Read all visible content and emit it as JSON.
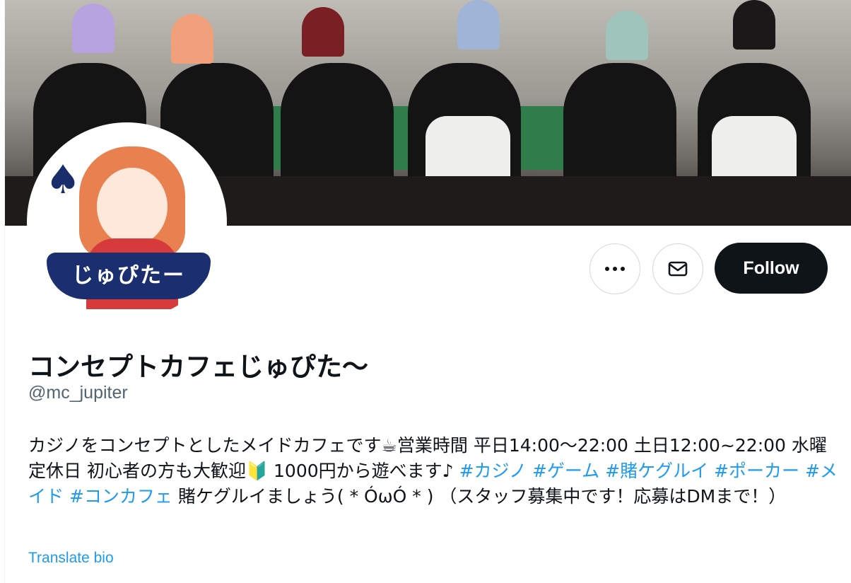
{
  "profile": {
    "display_name": "コンセプトカフェじゅぴた〜",
    "handle": "@mc_jupiter",
    "avatar_text": "じゅぴたー",
    "bio": {
      "segments": [
        {
          "text": "カジノをコンセプトとしたメイドカフェです☕営業時間 平日14:00〜22:00 土日12:00~22:00 水曜定休日 初心者の方も大歓迎🔰 1000円から遊べます♪ ",
          "tag": false
        },
        {
          "text": "#カジノ",
          "tag": true
        },
        {
          "text": " ",
          "tag": false
        },
        {
          "text": "#ゲーム",
          "tag": true
        },
        {
          "text": " ",
          "tag": false
        },
        {
          "text": "#賭ケグルイ",
          "tag": true
        },
        {
          "text": " ",
          "tag": false
        },
        {
          "text": "#ポーカー",
          "tag": true
        },
        {
          "text": " ",
          "tag": false
        },
        {
          "text": "#メイド",
          "tag": true
        },
        {
          "text": " ",
          "tag": false
        },
        {
          "text": "#コンカフェ",
          "tag": true
        },
        {
          "text": " 賭ケグルイましょう( * ÓωÓ * ) （スタッフ募集中です！応募はDMまで！）",
          "tag": false
        }
      ]
    },
    "translate_label": "Translate bio"
  },
  "actions": {
    "more_icon": "more-icon",
    "message_icon": "envelope-icon",
    "follow_label": "Follow"
  },
  "colors": {
    "link": "#1d9bf0",
    "text": "#0f1419",
    "muted": "#536471",
    "follow_bg": "#0f1419"
  }
}
